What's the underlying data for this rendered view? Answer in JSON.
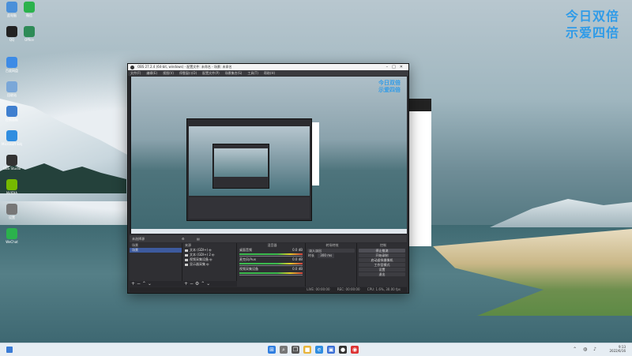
{
  "watermark": {
    "line1": "今日双倍",
    "line2": "示爱四倍"
  },
  "desktop_icons": [
    {
      "label": "此电脑",
      "color": "#4a90d9"
    },
    {
      "label": "微信",
      "color": "#2bb24c"
    },
    {
      "label": "QQ",
      "color": "#222222"
    },
    {
      "label": "Office",
      "color": "#2e8b57"
    },
    {
      "label": "百度网盘",
      "color": "#3d8be6"
    },
    {
      "label": "回收站",
      "color": "#7aa7d8"
    },
    {
      "label": "控制面板",
      "color": "#3f7fcf"
    },
    {
      "label": "Microsoft Edge",
      "color": "#2f8de0"
    },
    {
      "label": "OBS Studio",
      "color": "#333333"
    },
    {
      "label": "NVIDIA",
      "color": "#76b900"
    },
    {
      "label": "设置",
      "color": "#777777"
    },
    {
      "label": "WeChat",
      "color": "#2bb24c"
    }
  ],
  "obs": {
    "title": "OBS 27.2.4 (64-bit, windows) - 配置文件: 未命名 - 场景: 未命名",
    "menu": [
      "文件(F)",
      "编辑(E)",
      "视图(V)",
      "停靠窗口(D)",
      "配置文件(P)",
      "场景集合(S)",
      "工具(T)",
      "帮助(H)"
    ],
    "preview_watermark": {
      "line1": "今日双倍",
      "line2": "示爱四倍"
    },
    "dock_header_left": "未选择源",
    "dock_titles": {
      "scenes": "场景",
      "sources": "来源",
      "mixer": "混音器",
      "transitions": "转场特效",
      "controls": "控制"
    },
    "scenes": [
      "场景"
    ],
    "sources": [
      "文本 (GDI+)",
      "文本 (GDI+) 2",
      "视频采集设备",
      "显示器采集"
    ],
    "mixer": [
      {
        "name": "桌面音频",
        "level": "0.0 dB"
      },
      {
        "name": "麦克风/Aux",
        "level": "0.0 dB"
      },
      {
        "name": "视频采集设备",
        "level": "0.0 dB"
      }
    ],
    "transition": {
      "type": "淡入淡出",
      "duration_label": "时长",
      "duration": "300 ms"
    },
    "controls": [
      "停止推流",
      "开始录制",
      "启动虚拟摄像机",
      "工作室模式",
      "设置",
      "退出"
    ],
    "status": {
      "live": "LIVE: 00:00:00",
      "rec": "REC: 00:00:00",
      "cpu": "CPU: 1.6%, 30.00 fps"
    }
  },
  "taskbar": {
    "icons": [
      {
        "name": "windows-start",
        "color": "#2f7ee0",
        "glyph": "⊞"
      },
      {
        "name": "search",
        "color": "#777777",
        "glyph": "⌕"
      },
      {
        "name": "task-view",
        "color": "#555555",
        "glyph": "❐"
      },
      {
        "name": "file-explorer",
        "color": "#e8b43a",
        "glyph": "■"
      },
      {
        "name": "edge",
        "color": "#2f8de0",
        "glyph": "e"
      },
      {
        "name": "store",
        "color": "#3a6fd6",
        "glyph": "▣"
      },
      {
        "name": "obs",
        "color": "#333333",
        "glyph": "●"
      },
      {
        "name": "browser",
        "color": "#d33",
        "glyph": "◉"
      }
    ],
    "time": "9:13",
    "date": "2022/6/16"
  }
}
